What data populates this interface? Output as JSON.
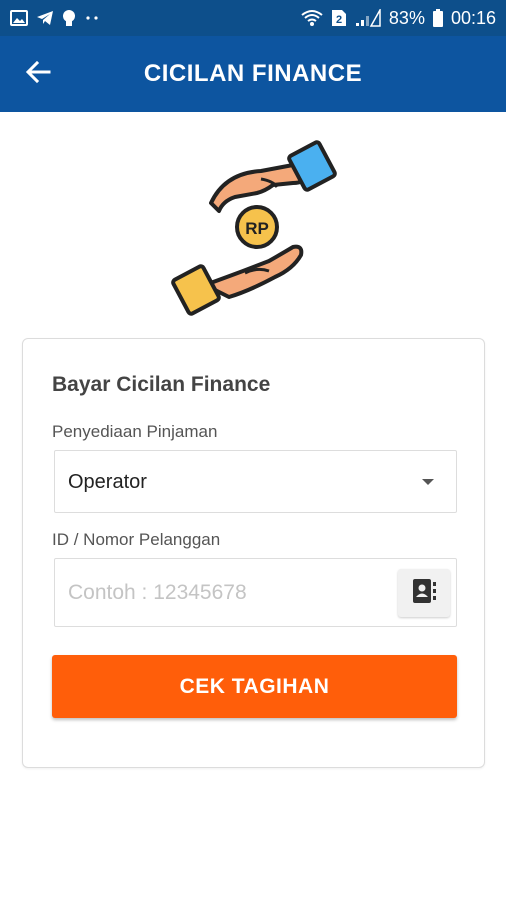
{
  "status_bar": {
    "battery_percent": "83%",
    "time": "00:16",
    "sim_slot": "2",
    "left_icons": [
      "image-icon",
      "telegram-icon",
      "bulb-icon",
      "more-dots-icon"
    ],
    "right_icons": [
      "wifi-icon",
      "sim-icon",
      "signal-icon",
      "battery-icon"
    ]
  },
  "app_bar": {
    "title": "CICILAN FINANCE",
    "back_icon": "arrow-left-icon"
  },
  "hero": {
    "coin_label": "RP"
  },
  "form": {
    "title": "Bayar Cicilan Finance",
    "provider_label": "Penyediaan Pinjaman",
    "provider_value": "Operator",
    "customer_id_label": "ID / Nomor Pelanggan",
    "customer_id_value": "",
    "customer_id_placeholder": "Contoh : 12345678",
    "contact_icon": "contact-book-icon",
    "submit_label": "CEK TAGIHAN"
  },
  "colors": {
    "app_bar": "#0d55a0",
    "status_bar": "#0d4f8b",
    "primary_button": "#ff5e0a",
    "hand_skin": "#f4a97a",
    "cuff_blue": "#4ab0f0",
    "cuff_yellow": "#f6c24c",
    "coin": "#f6c24c"
  }
}
